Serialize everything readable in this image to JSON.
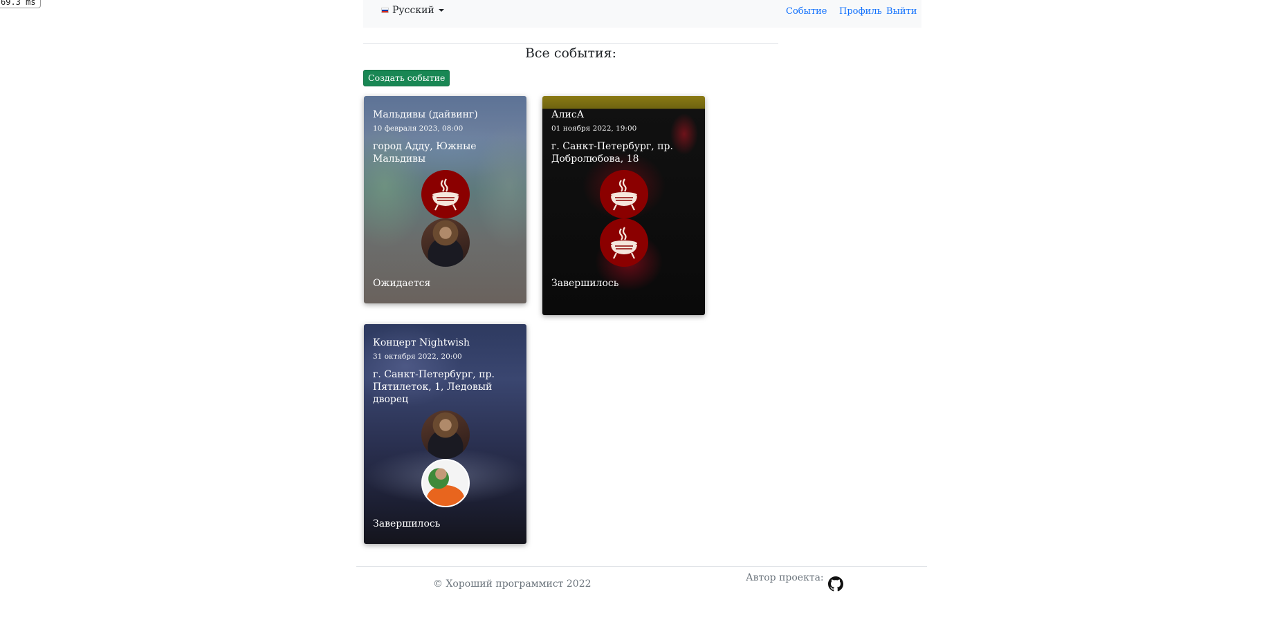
{
  "perf": "69.3 ms",
  "navbar": {
    "language": "Русский",
    "links": {
      "event": "Событие",
      "profile": "Профиль",
      "logout": "Выйти"
    }
  },
  "page": {
    "title": "Все события:",
    "create_button": "Создать событие"
  },
  "events": [
    {
      "title": "Мальдивы (дайвинг)",
      "date": "10 февраля 2023, 08:00",
      "address": "город Адду, Южные Мальдивы",
      "status": "Ожидается",
      "participants": [
        "grill-avatar",
        "woman-photo-avatar"
      ]
    },
    {
      "title": "АлисА",
      "date": "01 ноября 2022, 19:00",
      "address": "г. Санкт-Петербург, пр. Добролюбова, 18",
      "status": "Завершилось",
      "participants": [
        "grill-avatar",
        "grill-avatar"
      ]
    },
    {
      "title": "Концерт Nightwish",
      "date": "31 октября 2022, 20:00",
      "address": "г. Санкт-Петербург, пр. Пятилеток, 1, Ледовый дворец",
      "status": "Завершилось",
      "participants": [
        "woman-photo-avatar",
        "man-photo-avatar"
      ]
    }
  ],
  "footer": {
    "copyright": "© Хороший программист 2022",
    "author_label": "Автор проекта:",
    "github_icon": "github-icon"
  },
  "colors": {
    "create_button": "#198754",
    "nav_link": "#0d6efd",
    "grill_avatar_bg": "#8b0000"
  }
}
